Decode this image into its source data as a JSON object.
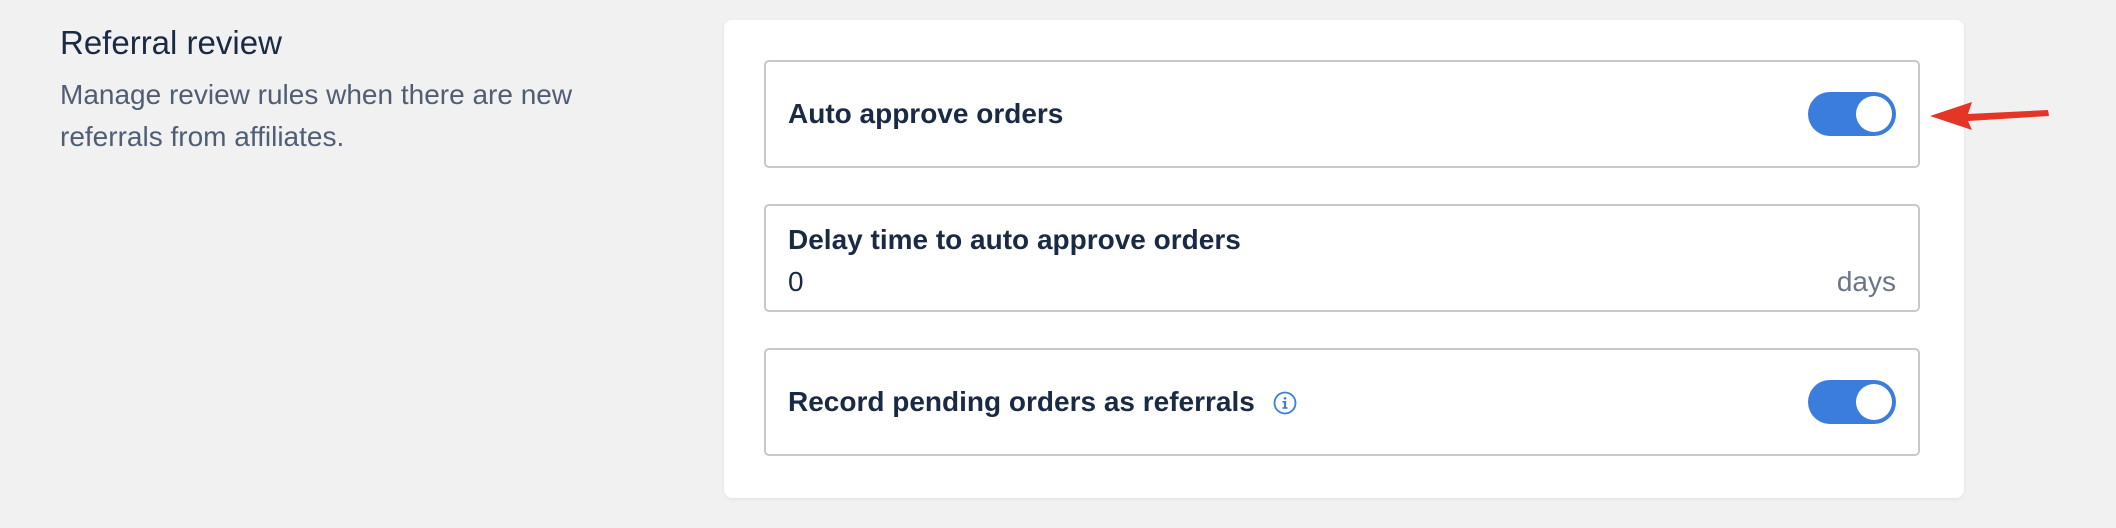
{
  "section": {
    "title": "Referral review",
    "description": "Manage review rules when there are new referrals from affiliates."
  },
  "settings": {
    "auto_approve": {
      "label": "Auto approve orders",
      "enabled": true
    },
    "delay": {
      "label": "Delay time to auto approve orders",
      "value": "0",
      "unit": "days"
    },
    "record_pending": {
      "label": "Record pending orders as referrals",
      "enabled": true,
      "icon": "info-icon"
    }
  },
  "colors": {
    "toggle_on": "#3b7ddd",
    "annotation_arrow": "#e53527",
    "heading": "#1b2a44",
    "muted": "#4f5e74"
  }
}
